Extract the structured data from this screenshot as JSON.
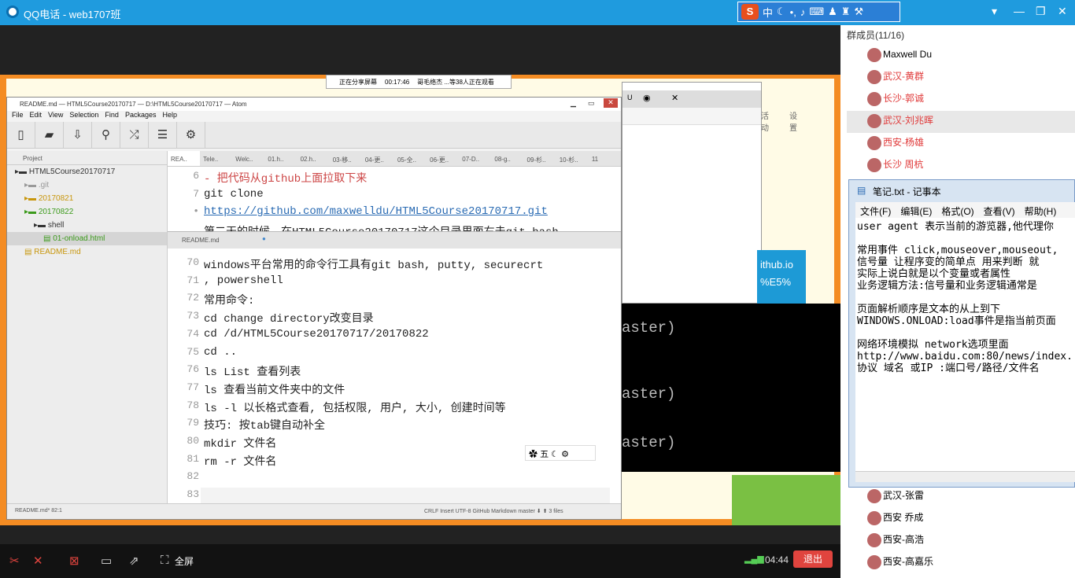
{
  "qq": {
    "title": "QQ电话 - web1707班",
    "ime_logo": "S",
    "ime_text": "中",
    "exit_label": "退出",
    "time": "04:44",
    "fullscreen_label": "全屏",
    "share_status": "正在分享屏幕",
    "share_time": "00:17:46",
    "share_viewers": "哥毛络杰 ...等38人正在观看"
  },
  "members": {
    "title": "群成员(11/16)",
    "list": [
      "Maxwell Du",
      "武汉-黄群",
      "长沙-郭诚",
      "武汉-刘兆晖",
      "西安-杨雄",
      "长沙 周杭"
    ],
    "list_bottom": [
      "武汉-张雷",
      "西安 乔成",
      "西安-高浩",
      "西安-高嘉乐"
    ]
  },
  "notepad": {
    "title": "笔记.txt - 记事本",
    "menu": [
      "文件(F)",
      "编辑(E)",
      "格式(O)",
      "查看(V)",
      "帮助(H)"
    ],
    "lines": [
      "user agent 表示当前的游览器,他代理你",
      "",
      "常用事件 click,mouseover,mouseout,",
      "信号量 让程序变的简单点 用来判断 就",
      "实际上说白就是以个变量或者属性",
      "业务逻辑方法:信号量和业务逻辑通常是",
      "",
      "页面解析顺序是文本的从上到下",
      "WINDOWS.ONLOAD:load事件是指当前页面",
      "",
      "网络环境模拟 network选项里面",
      "http://www.baidu.com:80/news/index.",
      "协议  域名 或IP :端口号/路径/文件名"
    ]
  },
  "atom": {
    "title": "README.md — HTML5Course20170717 — D:\\HTML5Course20170717 — Atom",
    "menu": [
      "File",
      "Edit",
      "View",
      "Selection",
      "Find",
      "Packages",
      "Help"
    ],
    "tree_header": "Project",
    "tree": [
      {
        "label": "HTML5Course20170717",
        "color": "#333"
      },
      {
        "label": ".git",
        "color": "#999"
      },
      {
        "label": "20170821",
        "color": "#c8960c"
      },
      {
        "label": "20170822",
        "color": "#3c9a1c"
      },
      {
        "label": "shell",
        "color": "#333"
      },
      {
        "label": "01-onload.html",
        "color": "#3c9a1c"
      },
      {
        "label": "README.md",
        "color": "#c8960c"
      }
    ],
    "tabs": [
      "REA..",
      "Tele..",
      "Welc..",
      "01.h..",
      "02.h..",
      "03-移..",
      "04-更..",
      "05-全..",
      "06-更..",
      "07-D..",
      "08-g..",
      "09-杉..",
      "10-杉..",
      "11"
    ],
    "pane1": [
      {
        "n": "6",
        "t": "- 把代码从github上面拉取下来"
      },
      {
        "n": "7",
        "t": "  git clone"
      },
      {
        "n": "•",
        "t": "  https://github.com/maxwelldu/HTML5Course20170717.git"
      },
      {
        "n": "",
        "t": "  第二天的时候，在HTML5Course20170717这个目录里面右击git bash"
      }
    ],
    "pane2_tab": "README.md",
    "pane2": [
      {
        "n": "70",
        "t": "windows平台常用的命令行工具有git bash, putty, securecrt"
      },
      {
        "n": "71",
        "t": ", powershell"
      },
      {
        "n": "72",
        "t": "常用命令:"
      },
      {
        "n": "73",
        "t": "cd change directory改变目录"
      },
      {
        "n": "74",
        "t": "  cd /d/HTML5Course20170717/20170822"
      },
      {
        "n": "75",
        "t": "  cd .."
      },
      {
        "n": "76",
        "t": "ls List 查看列表"
      },
      {
        "n": "77",
        "t": "  ls 查看当前文件夹中的文件"
      },
      {
        "n": "78",
        "t": "  ls -l 以长格式查看, 包括权限, 用户, 大小, 创建时间等"
      },
      {
        "n": "79",
        "t": "技巧: 按tab键自动补全"
      },
      {
        "n": "80",
        "t": "mkdir 文件名"
      },
      {
        "n": "81",
        "t": "rm -r 文件名"
      },
      {
        "n": "82",
        "t": ""
      },
      {
        "n": "83",
        "t": ""
      }
    ],
    "status_left": "README.md*   82:1",
    "status_right": "CRLF   Insert   UTF-8   GitHub Markdown   master   ⬇ ⬆   3 files",
    "ime_float": "五"
  },
  "terminal": {
    "lines": [
      "aster)",
      "aster)",
      "aster)"
    ]
  },
  "chrome": {
    "tab_label": "U",
    "menu_a": "活动",
    "menu_b": "设置",
    "panel_a": "ithub.io",
    "panel_b": "%E5%"
  },
  "colors": {
    "qq_blue": "#1f9bde",
    "exit_red": "#e0443e",
    "highlight": "#e03a3a"
  }
}
